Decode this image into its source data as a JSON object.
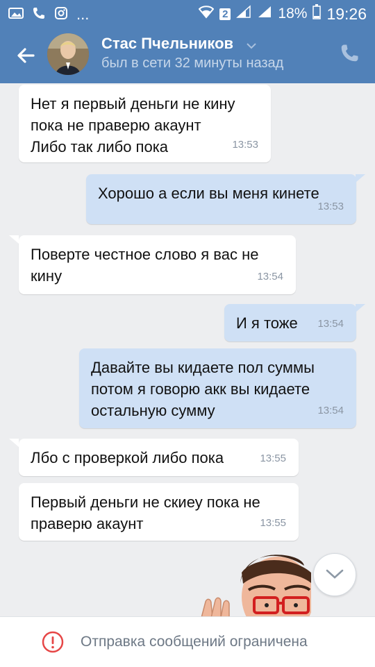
{
  "status_bar": {
    "battery": "18%",
    "time": "19:26",
    "sim": "2",
    "more": "..."
  },
  "header": {
    "name": "Стас Пчельников",
    "status": "был в сети 32 минуты назад"
  },
  "messages": [
    {
      "dir": "in",
      "text": "Нет я первый деньги не кину\nпока не праверю акаунт\nЛибо так либо пока",
      "time": "13:53"
    },
    {
      "dir": "out",
      "text": "Хорошо а если вы меня кинете",
      "time": "13:53"
    },
    {
      "dir": "in",
      "text": "Поверте честное слово я вас не\nкину",
      "time": "13:54"
    },
    {
      "dir": "out",
      "text": "И я тоже",
      "time": "13:54"
    },
    {
      "dir": "out",
      "text": "Давайте вы кидаете пол суммы\nпотом я говорю акк вы кидаете\nостальную сумму",
      "time": "13:54"
    },
    {
      "dir": "in",
      "text": "Лбо с проверкой либо пока",
      "time": "13:55"
    },
    {
      "dir": "in",
      "text": "Первый деньги не скиеу пока не\nправерю акаунт",
      "time": "13:55"
    }
  ],
  "footer": {
    "notice": "Отправка сообщений ограничена"
  },
  "colors": {
    "header_bg": "#5181b8",
    "incoming_bg": "#ffffff",
    "outgoing_bg": "#cfe0f5",
    "chat_bg": "#edeef0",
    "warning_red": "#e64646"
  }
}
